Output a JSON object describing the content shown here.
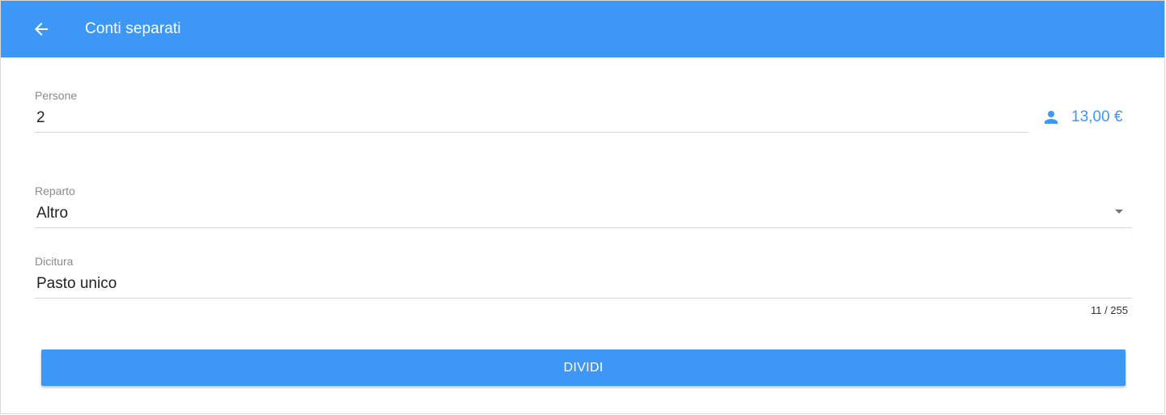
{
  "toolbar": {
    "title": "Conti separati",
    "back_icon": "arrow-left-icon",
    "background_color": "#3d97f7"
  },
  "form": {
    "persone": {
      "label": "Persone",
      "value": "2"
    },
    "per_person": {
      "icon": "person-icon",
      "amount": "13,00 €"
    },
    "reparto": {
      "label": "Reparto",
      "value": "Altro"
    },
    "dicitura": {
      "label": "Dicitura",
      "value": "Pasto unico",
      "counter": "11 / 255"
    }
  },
  "actions": {
    "divide_label": "DIVIDI"
  },
  "colors": {
    "accent": "#3d97f7",
    "label": "#8a8a8a",
    "text": "#222222",
    "divider": "#d6d6d6"
  }
}
